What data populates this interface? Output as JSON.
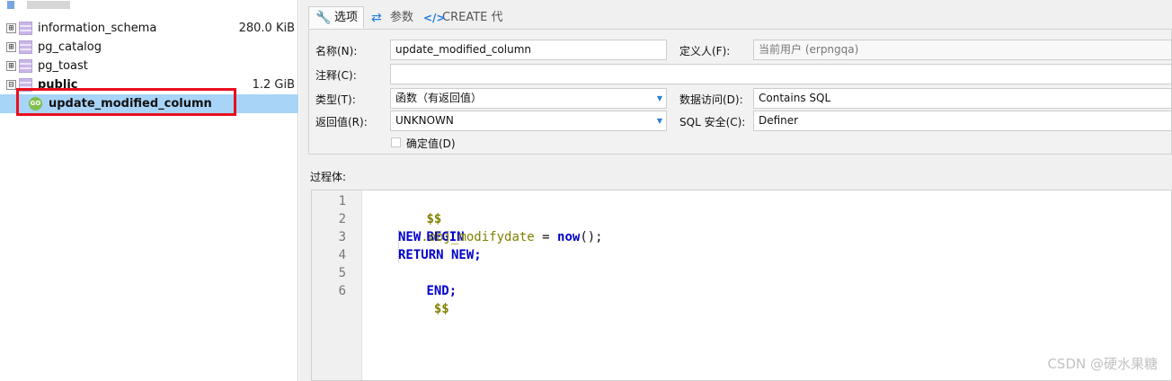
{
  "tree": {
    "rows": [
      {
        "label": "information_schema",
        "size": "280.0 KiB"
      },
      {
        "label": "pg_catalog",
        "size": ""
      },
      {
        "label": "pg_toast",
        "size": ""
      },
      {
        "label": "public",
        "size": "1.2 GiB"
      }
    ],
    "expanded_glyph": "⊟",
    "collapsed_glyph": "⊞",
    "function": {
      "icon_text": "GO",
      "label": "update_modified_column"
    }
  },
  "tabs": [
    {
      "label": "选项",
      "icon": "wrench-icon"
    },
    {
      "label": "参数",
      "icon": "arrows-icon"
    },
    {
      "label": "CREATE 代码",
      "icon": "code-icon"
    }
  ],
  "form": {
    "name_label": "名称(N):",
    "name_value": "update_modified_column",
    "definer_label": "定义人(F):",
    "definer_value": "当前用户 (erpngqa)",
    "comment_label": "注释(C):",
    "comment_value": "",
    "type_label": "类型(T):",
    "type_value": "函数（有返回值）",
    "data_access_label": "数据访问(D):",
    "data_access_value": "Contains SQL",
    "return_label": "返回值(R):",
    "return_value": "UNKNOWN",
    "sql_security_label": "SQL 安全(C):",
    "sql_security_value": "Definer",
    "deterministic_label": "确定值(D)"
  },
  "body_label": "过程体:",
  "code": {
    "line_numbers": [
      "1",
      "2",
      "3",
      "4",
      "5",
      "6"
    ],
    "l1": "$$",
    "l2": "BEGIN",
    "l3_new": "NEW",
    "l3_field": ".obj_modifydate",
    "l3_eq": " = ",
    "l3_now": "now",
    "l3_tail": "();",
    "l4_return": "RETURN",
    "l4_new": " NEW;",
    "l5": "END;",
    "l6": " $$"
  },
  "watermark": "CSDN @硬水果糖",
  "colors": {
    "keyword": "#0000cc",
    "identifier": "#808000",
    "selection": "#a8d4f7",
    "highlight_box": "#e8101e"
  }
}
